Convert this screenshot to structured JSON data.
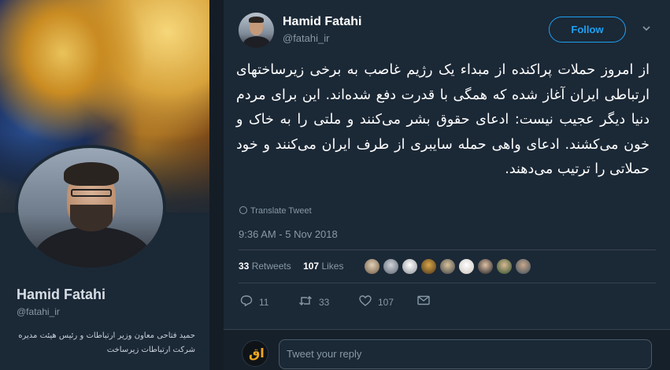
{
  "profile": {
    "name": "Hamid Fatahi",
    "handle": "@fatahi_ir",
    "bio": "حمید فتاحی معاون وزیر ارتباطات و رئیس هیئت مدیره شرکت ارتباطات زیرساخت"
  },
  "tweet": {
    "author_name": "Hamid Fatahi",
    "author_handle": "@fatahi_ir",
    "follow_label": "Follow",
    "text": "از امروز حملات پراکنده از مبداء یک رژیم غاصب به برخی زیرساختهای ارتباطی ایران آغاز شده که همگی با قدرت دفع شده‌اند. این برای مردم دنیا دیگر عجیب نیست: ادعای حقوق بشر می‌کنند و ملتی را به خاک و خون می‌کشند. ادعای واهی حمله سایبری از طرف ایران می‌کنند و خود حملاتی را ترتیب می‌دهند.",
    "translate_label": "Translate Tweet",
    "timestamp": "9:36 AM - 5 Nov 2018",
    "retweets_count": "33",
    "retweets_label": "Retweets",
    "likes_count": "107",
    "likes_label": "Likes",
    "reply_count": "11",
    "retweet_action_count": "33",
    "like_action_count": "107",
    "reply_placeholder": "Tweet your reply"
  },
  "colors": {
    "background": "#141d26",
    "panel": "#1b2836",
    "accent": "#1da1f2",
    "muted": "#8899a6"
  },
  "icons": {
    "more": "chevron-down-icon",
    "translate": "globe-icon",
    "reply": "reply-icon",
    "retweet": "retweet-icon",
    "like": "heart-icon",
    "message": "envelope-icon"
  }
}
